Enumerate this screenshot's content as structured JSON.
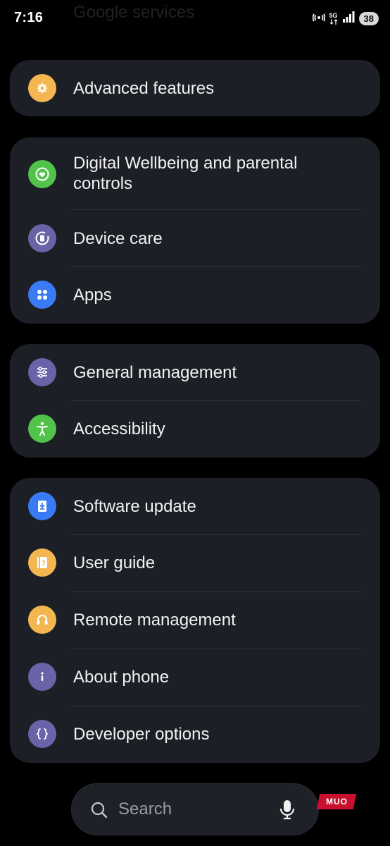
{
  "status_bar": {
    "time": "7:16",
    "battery": "38",
    "network": "5G"
  },
  "header_ghost": "Google services",
  "cards": [
    {
      "rows": [
        {
          "label": "Advanced features",
          "icon": "advanced-features-icon",
          "color": "#f4b650"
        }
      ]
    },
    {
      "rows": [
        {
          "label": "Digital Wellbeing and parental controls",
          "icon": "digital-wellbeing-icon",
          "color": "#52c34a"
        },
        {
          "label": "Device care",
          "icon": "device-care-icon",
          "color": "#6a63a8"
        },
        {
          "label": "Apps",
          "icon": "apps-icon",
          "color": "#3a7bf5"
        }
      ]
    },
    {
      "rows": [
        {
          "label": "General management",
          "icon": "general-management-icon",
          "color": "#6a63a8"
        },
        {
          "label": "Accessibility",
          "icon": "accessibility-icon",
          "color": "#52c34a"
        }
      ]
    },
    {
      "rows": [
        {
          "label": "Software update",
          "icon": "software-update-icon",
          "color": "#3a7bf5"
        },
        {
          "label": "User guide",
          "icon": "user-guide-icon",
          "color": "#f4b650"
        },
        {
          "label": "Remote management",
          "icon": "remote-management-icon",
          "color": "#f4b650"
        },
        {
          "label": "About phone",
          "icon": "about-phone-icon",
          "color": "#6a63a8"
        },
        {
          "label": "Developer options",
          "icon": "developer-options-icon",
          "color": "#6a63a8"
        }
      ]
    }
  ],
  "search": {
    "placeholder": "Search"
  },
  "watermark": "MUO"
}
